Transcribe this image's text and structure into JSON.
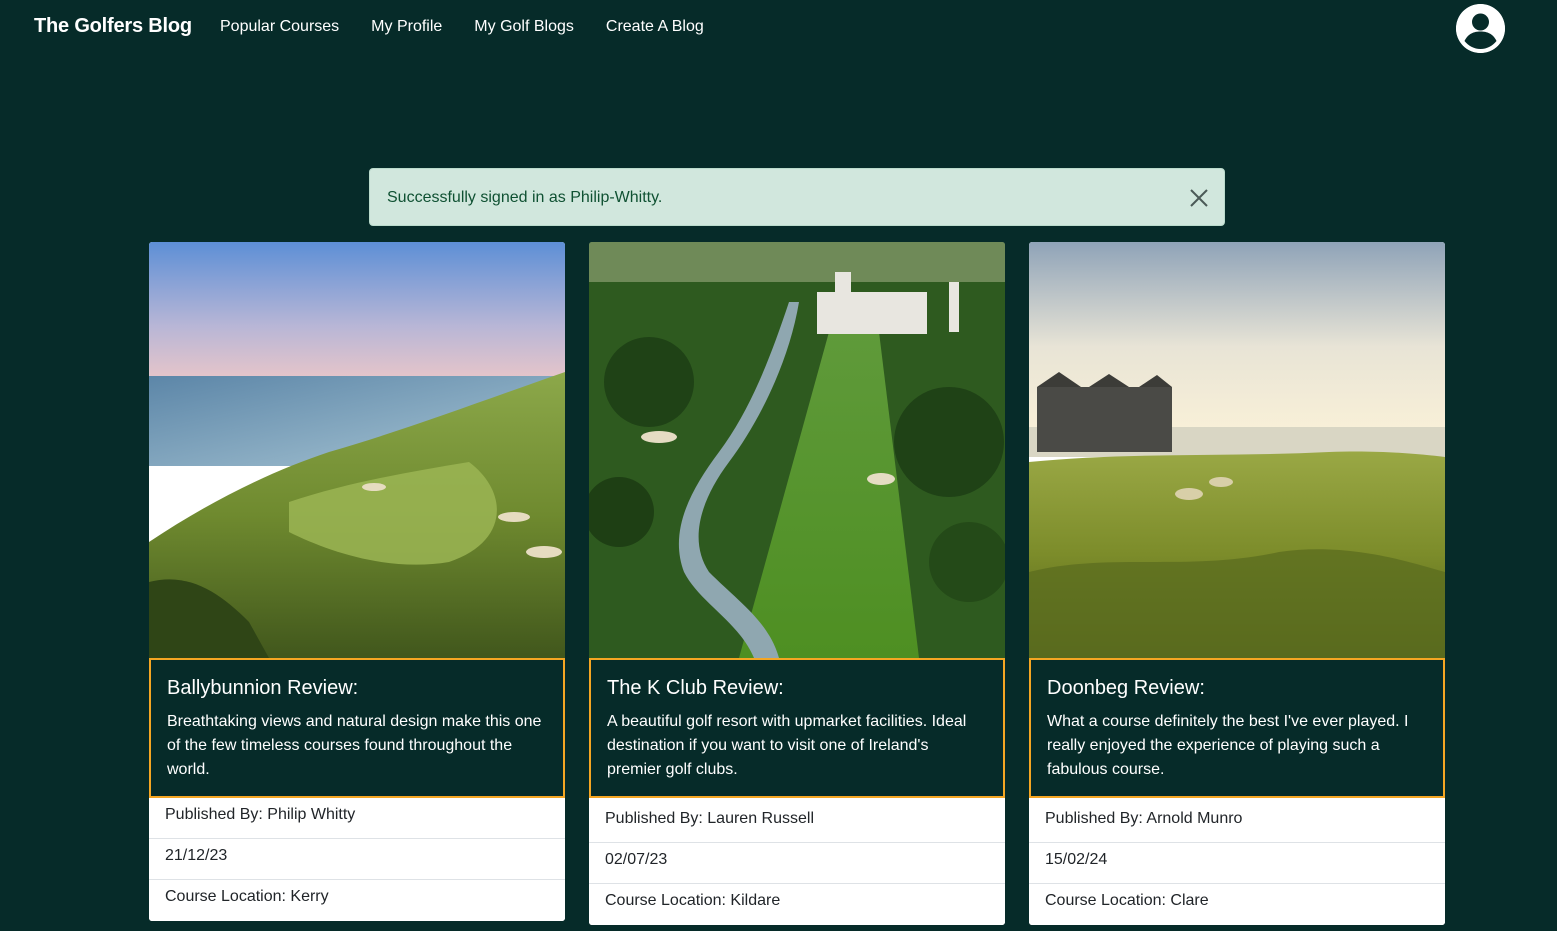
{
  "nav": {
    "brand": "The Golfers Blog",
    "links": [
      "Popular Courses",
      "My Profile",
      "My Golf Blogs",
      "Create A Blog"
    ]
  },
  "alert": {
    "message": "Successfully signed in as Philip-Whitty."
  },
  "cards": [
    {
      "title": "Ballybunnion Review:",
      "excerpt": "Breathtaking views and natural design make this one of the few timeless courses found throughout the world.",
      "published_by": "Published By: Philip Whitty",
      "date": "21/12/23",
      "location": "Course Location: Kerry"
    },
    {
      "title": "The K Club Review:",
      "excerpt": "A beautiful golf resort with upmarket facilities. Ideal destination if you want to visit one of Ireland's premier golf clubs.",
      "published_by": "Published By: Lauren Russell",
      "date": "02/07/23",
      "location": "Course Location: Kildare"
    },
    {
      "title": "Doonbeg Review:",
      "excerpt": "What a course definitely the best I've ever played. I really enjoyed the experience of playing such a fabulous course.",
      "published_by": "Published By: Arnold Munro",
      "date": "15/02/24",
      "location": "Course Location: Clare"
    }
  ],
  "colors": {
    "background": "#062b29",
    "card_border_accent": "#f5a623",
    "alert_bg": "#d1e7dd",
    "alert_text": "#0f5132"
  },
  "icons": {
    "avatar": "user-circle-icon",
    "close": "close-icon"
  }
}
